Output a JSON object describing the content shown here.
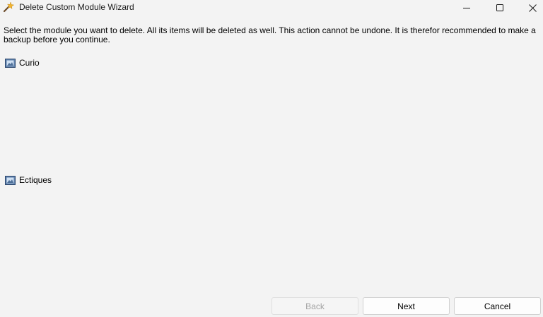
{
  "window": {
    "title": "Delete Custom Module Wizard",
    "icon": "magic-wand-icon"
  },
  "controls": {
    "minimize_icon": "minimize-icon",
    "maximize_icon": "maximize-icon",
    "close_icon": "close-icon"
  },
  "main": {
    "instructions": "Select the module you want to delete. All its items will be deleted as well. This action cannot be undone. It is therefor recommended to make a backup before you continue.",
    "modules": [
      {
        "label": "Curio",
        "icon": "module-icon"
      },
      {
        "label": "Ectiques",
        "icon": "module-icon"
      }
    ]
  },
  "footer": {
    "back_label": "Back",
    "back_enabled": false,
    "next_label": "Next",
    "cancel_label": "Cancel"
  },
  "colors": {
    "background": "#f3f3f3",
    "disabled_text": "#a3a3a3"
  }
}
